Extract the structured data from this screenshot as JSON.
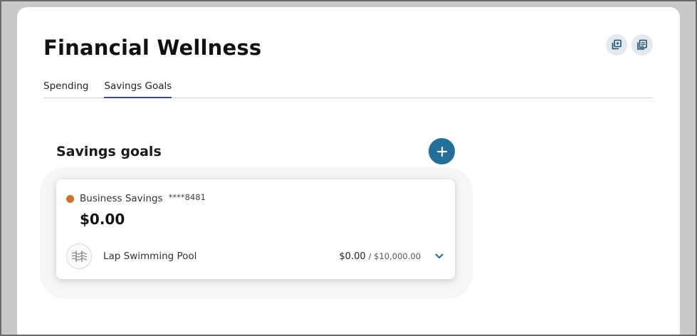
{
  "page": {
    "title": "Financial Wellness",
    "actions": [
      {
        "icon": "copy-icon"
      },
      {
        "icon": "document-list-icon"
      }
    ]
  },
  "tabs": [
    {
      "label": "Spending",
      "active": false
    },
    {
      "label": "Savings Goals",
      "active": true
    }
  ],
  "savings": {
    "section_title": "Savings goals",
    "add_icon": "plus-icon",
    "account": {
      "name": "Business Savings",
      "masked_number": "****8481",
      "balance": "$0.00",
      "dot_color": "#d0722a"
    },
    "goal": {
      "icon": "swimming-pool-icon",
      "name": "Lap Swimming Pool",
      "current": "$0.00",
      "target": "/ $10,000.00",
      "expand_icon": "chevron-down-icon"
    }
  },
  "colors": {
    "accent": "#226f99",
    "tab_underline": "#3b4aa0"
  }
}
